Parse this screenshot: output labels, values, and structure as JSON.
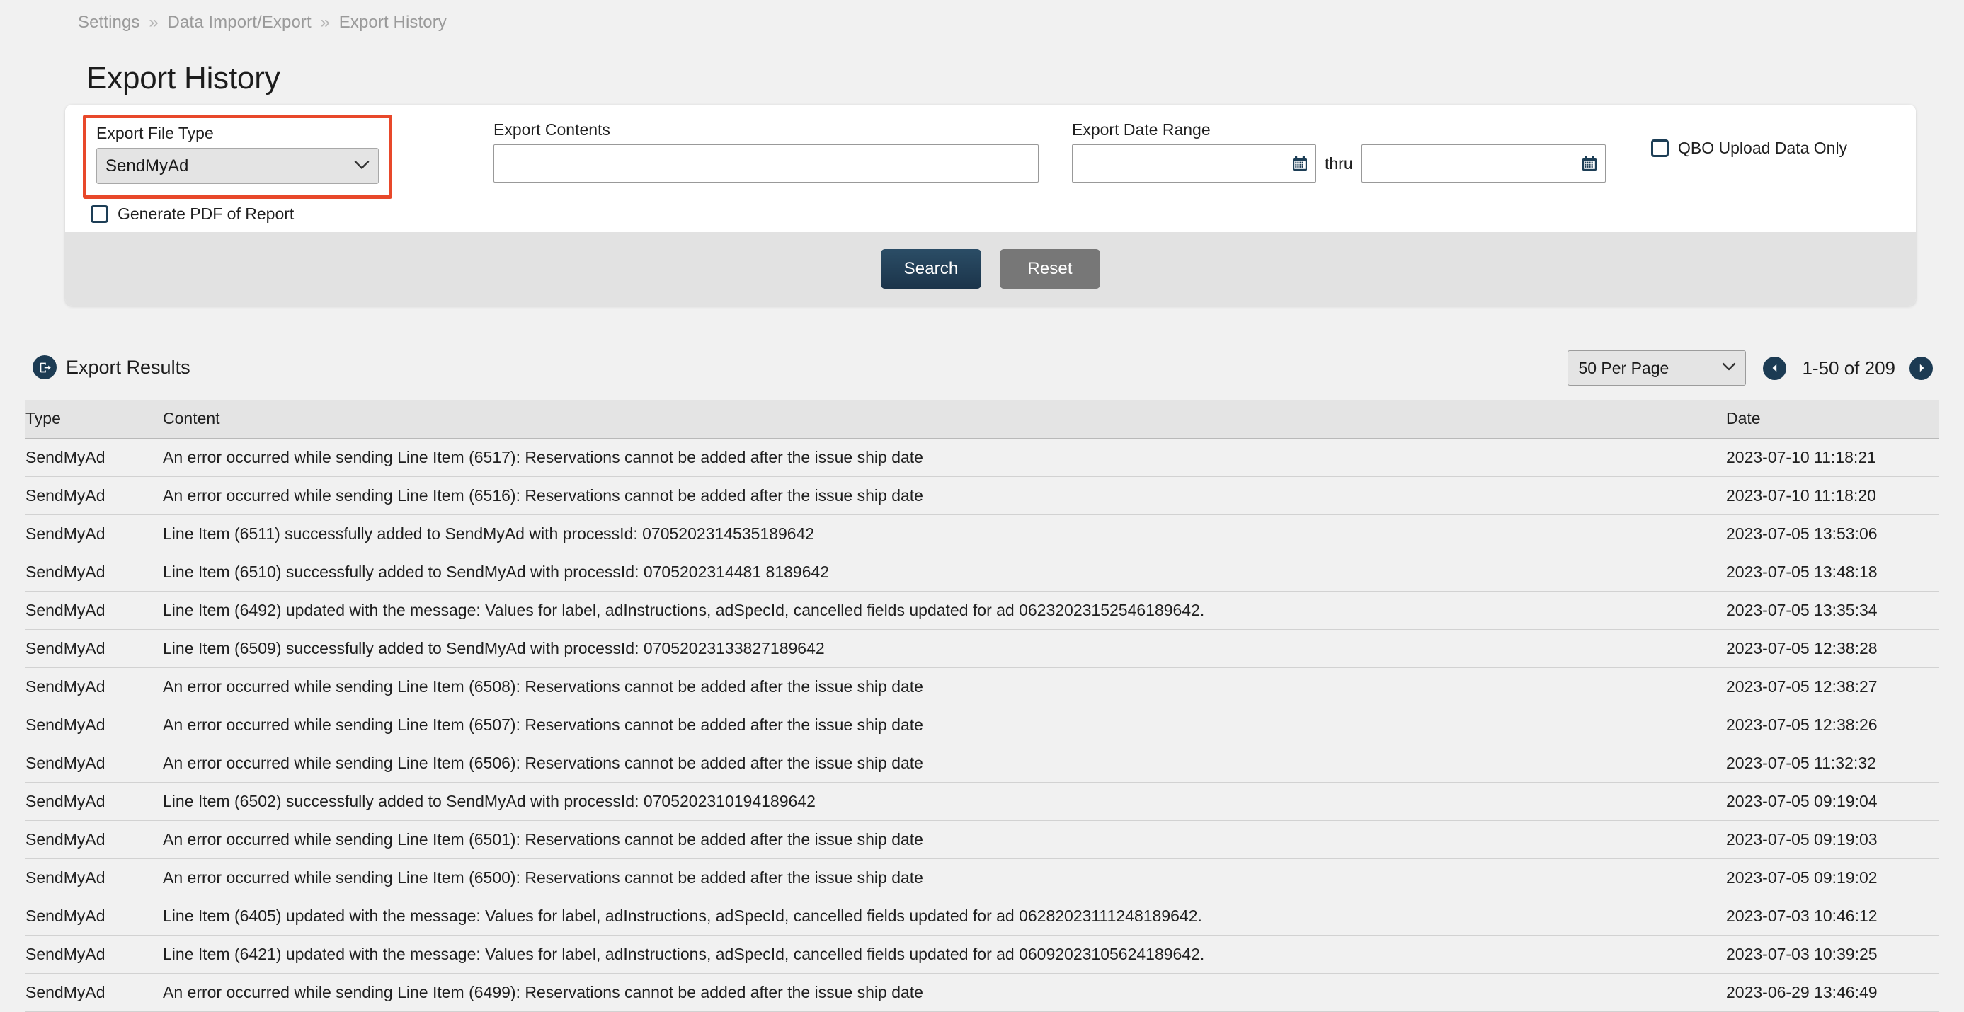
{
  "breadcrumb": {
    "items": [
      "Settings",
      "Data Import/Export",
      "Export History"
    ],
    "separator": "»"
  },
  "page": {
    "title": "Export History"
  },
  "search_panel": {
    "export_file_type": {
      "label": "Export File Type",
      "value": "SendMyAd",
      "options": [
        "SendMyAd"
      ],
      "highlight_color": "#e8482a",
      "chevron": "chevron-down-icon"
    },
    "generate_pdf": {
      "label": "Generate PDF of Report",
      "checked": false
    },
    "export_contents": {
      "label": "Export Contents",
      "value": "",
      "placeholder": ""
    },
    "export_date_range": {
      "label": "Export Date Range",
      "from_value": "",
      "from_placeholder": "",
      "to_value": "",
      "to_placeholder": "",
      "separator_label": "thru",
      "calendar_icon": "calendar-icon"
    },
    "qbo_upload_data_only": {
      "label": "QBO Upload Data Only",
      "checked": false
    },
    "buttons": {
      "search": "Search",
      "reset": "Reset",
      "search_color": "#1b344a",
      "reset_color": "#777777"
    }
  },
  "results": {
    "icon": "export-icon",
    "title": "Export Results",
    "per_page": {
      "selected": "50 Per Page",
      "options": [
        "50 Per Page"
      ]
    },
    "pagination": {
      "range_text": "1-50 of 209",
      "prev_icon": "chevron-left-icon",
      "next_icon": "chevron-right-icon"
    },
    "columns": [
      "Type",
      "Content",
      "Date"
    ],
    "rows": [
      {
        "type": "SendMyAd",
        "content": "An error occurred while sending Line Item (6517): Reservations cannot be added after the issue ship date",
        "date": "2023-07-10 11:18:21"
      },
      {
        "type": "SendMyAd",
        "content": "An error occurred while sending Line Item (6516): Reservations cannot be added after the issue ship date",
        "date": "2023-07-10 11:18:20"
      },
      {
        "type": "SendMyAd",
        "content": "Line Item (6511) successfully added to SendMyAd with processId: 0705202314535189642",
        "date": "2023-07-05 13:53:06"
      },
      {
        "type": "SendMyAd",
        "content": "Line Item (6510) successfully added to SendMyAd with processId: 0705202314481 8189642",
        "date": "2023-07-05 13:48:18"
      },
      {
        "type": "SendMyAd",
        "content": "Line Item (6492) updated with the message: Values for label, adInstructions, adSpecId, cancelled fields updated for ad 06232023152546189642.",
        "date": "2023-07-05 13:35:34"
      },
      {
        "type": "SendMyAd",
        "content": "Line Item (6509) successfully added to SendMyAd with processId: 07052023133827189642",
        "date": "2023-07-05 12:38:28"
      },
      {
        "type": "SendMyAd",
        "content": "An error occurred while sending Line Item (6508): Reservations cannot be added after the issue ship date",
        "date": "2023-07-05 12:38:27"
      },
      {
        "type": "SendMyAd",
        "content": "An error occurred while sending Line Item (6507): Reservations cannot be added after the issue ship date",
        "date": "2023-07-05 12:38:26"
      },
      {
        "type": "SendMyAd",
        "content": "An error occurred while sending Line Item (6506): Reservations cannot be added after the issue ship date",
        "date": "2023-07-05 11:32:32"
      },
      {
        "type": "SendMyAd",
        "content": "Line Item (6502) successfully added to SendMyAd with processId: 0705202310194189642",
        "date": "2023-07-05 09:19:04"
      },
      {
        "type": "SendMyAd",
        "content": "An error occurred while sending Line Item (6501): Reservations cannot be added after the issue ship date",
        "date": "2023-07-05 09:19:03"
      },
      {
        "type": "SendMyAd",
        "content": "An error occurred while sending Line Item (6500): Reservations cannot be added after the issue ship date",
        "date": "2023-07-05 09:19:02"
      },
      {
        "type": "SendMyAd",
        "content": "Line Item (6405) updated with the message: Values for label, adInstructions, adSpecId, cancelled fields updated for ad 06282023111248189642.",
        "date": "2023-07-03 10:46:12"
      },
      {
        "type": "SendMyAd",
        "content": "Line Item (6421) updated with the message: Values for label, adInstructions, adSpecId, cancelled fields updated for ad 06092023105624189642.",
        "date": "2023-07-03 10:39:25"
      },
      {
        "type": "SendMyAd",
        "content": "An error occurred while sending Line Item (6499): Reservations cannot be added after the issue ship date",
        "date": "2023-06-29 13:46:49"
      }
    ]
  }
}
